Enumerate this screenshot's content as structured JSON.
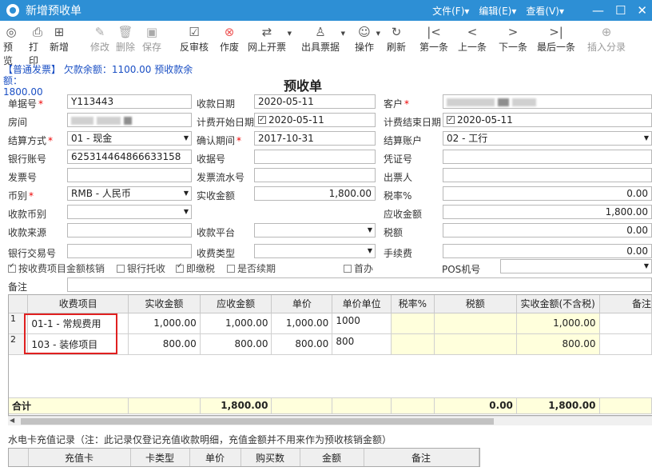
{
  "window": {
    "title": "新增预收单",
    "menus": [
      "文件(F)▾",
      "编辑(E)▾",
      "查看(V)▾"
    ],
    "controls": [
      "—",
      "☐",
      "✕"
    ]
  },
  "toolbar": [
    {
      "label": "预览",
      "icon": "eye-icon",
      "glyph": "◎",
      "enabled": true
    },
    {
      "label": "打印",
      "icon": "printer-icon",
      "glyph": "⎙",
      "enabled": true
    },
    {
      "label": "新增",
      "icon": "add-icon",
      "glyph": "⊞",
      "enabled": true
    },
    {
      "label": "修改",
      "icon": "edit-icon",
      "glyph": "✎",
      "enabled": false
    },
    {
      "label": "删除",
      "icon": "trash-icon",
      "glyph": "🗑",
      "enabled": false
    },
    {
      "label": "保存",
      "icon": "save-icon",
      "glyph": "▣",
      "enabled": false
    },
    {
      "label": "反审核",
      "icon": "unaudit-icon",
      "glyph": "☑",
      "enabled": true
    },
    {
      "label": "作废",
      "icon": "void-icon",
      "glyph": "⊗",
      "enabled": true
    },
    {
      "label": "网上开票",
      "icon": "transfer-icon",
      "glyph": "⇄",
      "enabled": true,
      "dropdown": true
    },
    {
      "label": "出具票据",
      "icon": "receipt-icon",
      "glyph": "♙",
      "enabled": true,
      "dropdown": true
    },
    {
      "label": "操作",
      "icon": "operation-icon",
      "glyph": "☺",
      "enabled": true,
      "dropdown": true
    },
    {
      "label": "刷新",
      "icon": "refresh-icon",
      "glyph": "↻",
      "enabled": true
    },
    {
      "label": "第一条",
      "icon": "first-icon",
      "glyph": "|<",
      "enabled": true
    },
    {
      "label": "上一条",
      "icon": "prev-icon",
      "glyph": "<",
      "enabled": true
    },
    {
      "label": "下一条",
      "icon": "next-icon",
      "glyph": ">",
      "enabled": true
    },
    {
      "label": "最后一条",
      "icon": "last-icon",
      "glyph": ">|",
      "enabled": true
    },
    {
      "label": "插入分录",
      "icon": "insert-entry-icon",
      "glyph": "⊕",
      "enabled": false
    }
  ],
  "info": {
    "line1": "【普通发票】 欠款余额：1100.00 预收款余额：",
    "line2": "1800.00"
  },
  "doc_title": "预收单",
  "form": {
    "doc_no_label": "单据号",
    "doc_no": "Y113443",
    "receipt_date_label": "收款日期",
    "receipt_date": "2020-05-11",
    "customer_label": "客户",
    "room_label": "房间",
    "bill_start_label": "计费开始日期",
    "bill_start": "2020-05-11",
    "bill_end_label": "计费结束日期",
    "bill_end": "2020-05-11",
    "settle_method_label": "结算方式",
    "settle_method": "01 - 现金",
    "confirm_period_label": "确认期间",
    "confirm_period": "2017-10-31",
    "settle_account_label": "结算账户",
    "settle_account": "02 - 工行",
    "bank_account_label": "银行账号",
    "bank_account": "625314464866633158",
    "receipt_no_label": "收据号",
    "voucher_no_label": "凭证号",
    "invoice_no_label": "发票号",
    "invoice_serial_label": "发票流水号",
    "issuer_label": "出票人",
    "currency_label": "币别",
    "currency": "RMB - 人民币",
    "actual_amount_label": "实收金额",
    "actual_amount": "1,800.00",
    "tax_rate_label": "税率%",
    "tax_rate": "0.00",
    "recv_currency_label": "收款币别",
    "receivable_label": "应收金额",
    "receivable": "1,800.00",
    "source_label": "收款来源",
    "platform_label": "收款平台",
    "tax_label": "税额",
    "tax": "0.00",
    "bank_txn_label": "银行交易号",
    "receipt_type_label": "收费类型",
    "fee_label": "手续费",
    "fee": "0.00",
    "pos_label": "POS机号",
    "remark_label": "备注"
  },
  "checkboxes": [
    {
      "label": "按收费项目金额核销",
      "checked": true
    },
    {
      "label": "银行托收",
      "checked": false
    },
    {
      "label": "即缴税",
      "checked": true
    },
    {
      "label": "是否续期",
      "checked": false
    },
    {
      "label": "首办",
      "checked": false
    }
  ],
  "grid": {
    "columns": [
      "",
      "收费项目",
      "实收金额",
      "应收金额",
      "单价",
      "单价单位",
      "税率%",
      "税额",
      "实收金额(不含税)",
      "备注"
    ],
    "rows": [
      {
        "idx": "1",
        "item": "01-1 - 常规费用",
        "actual": "1,000.00",
        "receivable": "1,000.00",
        "price": "1,000.00",
        "unit": "1000",
        "rate": "",
        "tax": "",
        "net": "1,000.00",
        "note": ""
      },
      {
        "idx": "2",
        "item": "103 - 装修项目",
        "actual": "800.00",
        "receivable": "800.00",
        "price": "800.00",
        "unit": "800",
        "rate": "",
        "tax": "",
        "net": "800.00",
        "note": ""
      }
    ],
    "total": {
      "label": "合计",
      "receivable": "1,800.00",
      "tax": "0.00",
      "net": "1,800.00"
    }
  },
  "card_section": {
    "title": "水电卡充值记录（注：此记录仅登记充值收款明细，充值金额并不用来作为预收核销金额）",
    "columns": [
      "",
      "充值卡",
      "卡类型",
      "单价",
      "购买数",
      "金额",
      "备注"
    ]
  }
}
